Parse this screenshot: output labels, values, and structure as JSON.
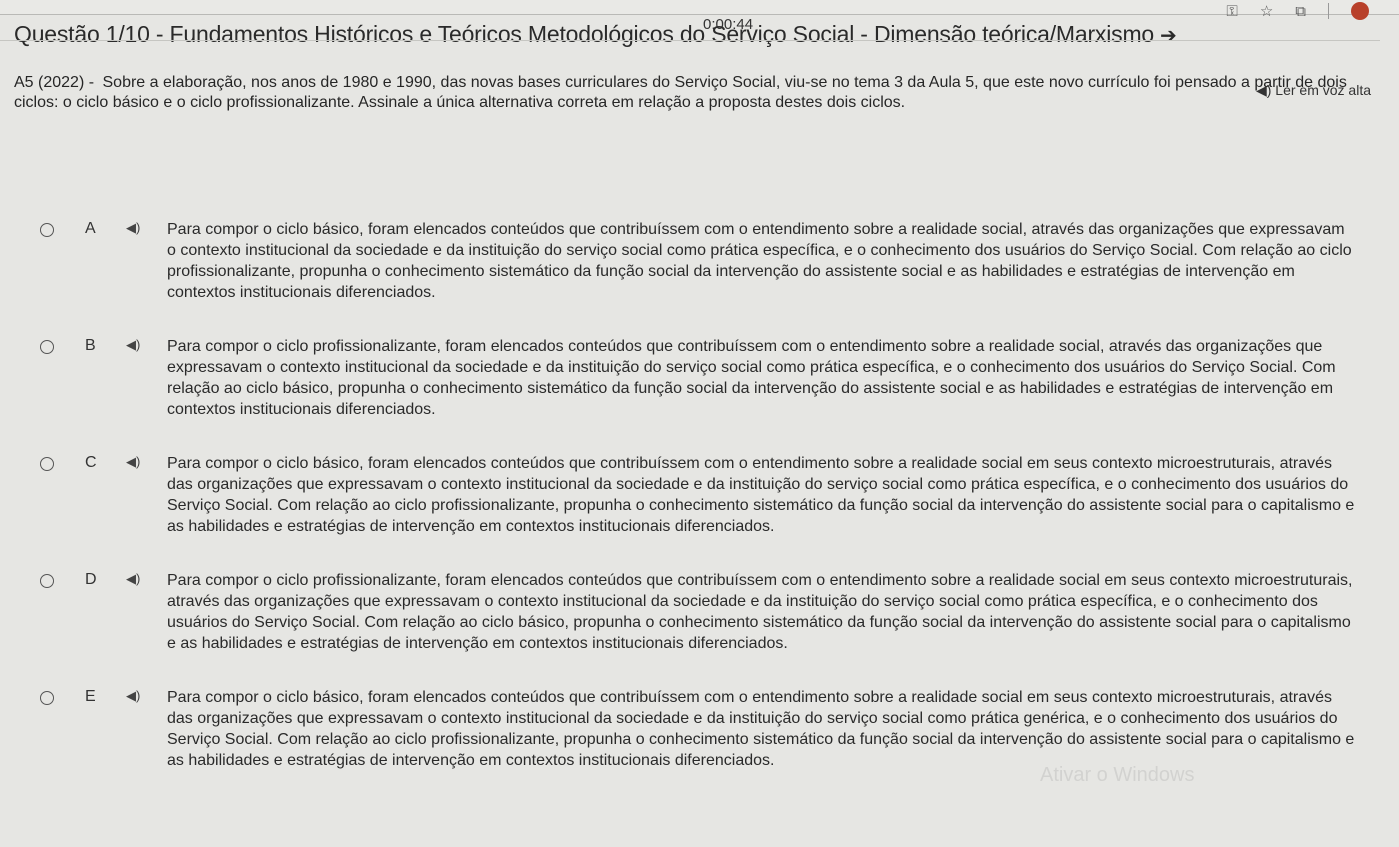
{
  "timer": "0:00:44",
  "browser": {
    "icons": [
      "key-icon",
      "star-icon",
      "extension-icon",
      "profile-avatar"
    ]
  },
  "question": {
    "title": "Questão 1/10 - Fundamentos Históricos e Teóricos Metodológicos do Serviço Social - Dimensão teórica/Marxismo",
    "title_arrow": "➔",
    "tts_label": "◀︎) Ler em voz alta",
    "id": "A5 (2022) -",
    "statement": "Sobre a elaboração, nos anos de 1980 e 1990, das novas bases curriculares do Serviço Social, viu-se no tema 3 da Aula 5, que este novo currículo foi pensado a partir de dois ciclos: o ciclo básico e o ciclo profissionalizante. Assinale a única alternativa correta em relação a proposta destes dois ciclos."
  },
  "options": [
    {
      "letter": "A",
      "text": "Para compor o ciclo básico, foram elencados conteúdos que contribuíssem com o entendimento sobre a realidade social, através das organizações que expressavam o contexto institucional da sociedade e da instituição do serviço social como prática específica, e o conhecimento dos usuários do Serviço Social. Com relação ao ciclo profissionalizante, propunha o conhecimento sistemático da função social da intervenção do assistente social e as habilidades e estratégias de intervenção em contextos institucionais diferenciados."
    },
    {
      "letter": "B",
      "text": "Para compor o ciclo profissionalizante, foram elencados conteúdos que contribuíssem com o entendimento sobre a realidade social, através das organizações que expressavam o contexto institucional da sociedade e da instituição do serviço social como prática específica, e o conhecimento dos usuários do Serviço Social. Com relação ao ciclo básico, propunha o conhecimento sistemático da função social da intervenção do assistente social e as habilidades e estratégias de intervenção em contextos institucionais diferenciados."
    },
    {
      "letter": "C",
      "text": "Para compor o ciclo básico, foram elencados conteúdos que contribuíssem com o entendimento sobre a realidade social em seus contexto microestruturais, através das organizações que expressavam o contexto institucional da sociedade e da instituição do serviço social como prática específica, e o conhecimento dos usuários do Serviço Social. Com relação ao ciclo profissionalizante, propunha o conhecimento sistemático da função social da intervenção do assistente social para o capitalismo e as habilidades e estratégias de intervenção em contextos institucionais diferenciados."
    },
    {
      "letter": "D",
      "text": "Para compor o ciclo profissionalizante, foram elencados conteúdos que contribuíssem com o entendimento sobre a realidade social em seus contexto microestruturais, através das organizações que expressavam o contexto institucional da sociedade e da instituição do serviço social como prática específica, e o conhecimento dos usuários do Serviço Social. Com relação ao ciclo básico, propunha o conhecimento sistemático da função social da intervenção do assistente social para o capitalismo e as habilidades e estratégias de intervenção em contextos institucionais diferenciados."
    },
    {
      "letter": "E",
      "text": "Para compor o ciclo básico, foram elencados conteúdos que contribuíssem com o entendimento sobre a realidade social em seus contexto microestruturais, através das organizações que expressavam o contexto institucional da sociedade e da instituição do serviço social como prática genérica, e o conhecimento dos usuários do Serviço Social. Com relação ao ciclo profissionalizante, propunha o conhecimento sistemático da função social da intervenção do assistente social para o capitalismo e as habilidades e estratégias de intervenção em contextos institucionais diferenciados."
    }
  ],
  "speaker_glyph": "◀︎)",
  "watermark": "Ativar o Windows"
}
